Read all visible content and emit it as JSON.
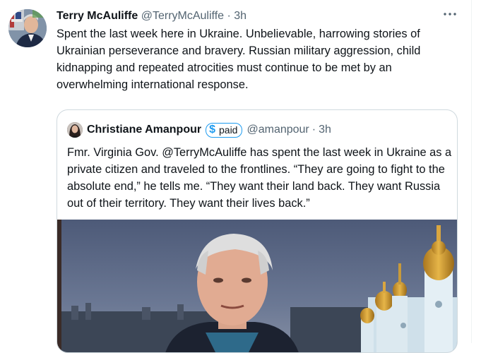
{
  "tweet": {
    "author_name": "Terry McAuliffe",
    "handle": "@TerryMcAuliffe",
    "separator": "·",
    "time": "3h",
    "more_icon": "more-horizontal-icon",
    "text": "Spent the last week here in Ukraine. Unbelievable, harrowing stories of Ukrainian perseverance and bravery. Russian military aggression, child kidnapping and repeated atrocities must continue to be met by an overwhelming international response."
  },
  "quote": {
    "author_name": "Christiane Amanpour",
    "badge_icon": "dollar-icon",
    "badge_label": "paid",
    "handle": "@amanpour",
    "separator": "·",
    "time": "3h",
    "text": "Fmr. Virginia Gov. @TerryMcAuliffe has spent the last week in Ukraine as a private citizen and traveled to the frontlines. “They are going to fight to the absolute end,” he tells me. “They want their land back. They want Russia out of their territory. They want their lives back.”"
  },
  "colors": {
    "text_primary": "#0f1419",
    "text_muted": "#536471",
    "accent_blue": "#1d9bf0",
    "border": "#cfd9de"
  }
}
